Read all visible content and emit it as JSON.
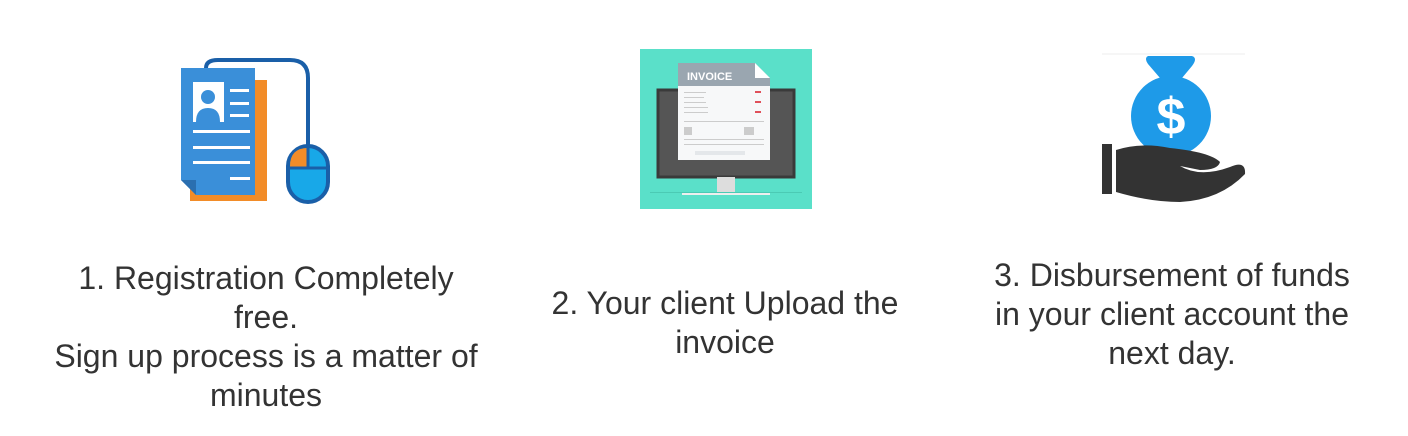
{
  "steps": [
    {
      "icon": "resume-mouse-icon",
      "lines": [
        "1. Registration Completely",
        "free.",
        "Sign up process is a matter of",
        "minutes"
      ]
    },
    {
      "icon": "invoice-monitor-icon",
      "invoice_label": "INVOICE",
      "lines": [
        "2. Your client Upload the",
        "invoice"
      ]
    },
    {
      "icon": "money-bag-hand-icon",
      "lines": [
        "3. Disbursement of funds",
        "in your client account the",
        "next day."
      ]
    }
  ],
  "colors": {
    "blue": "#3a8fd9",
    "orange": "#f28c28",
    "teal": "#5ae0c9",
    "dark": "#333333",
    "bag": "#1e9ae8"
  }
}
